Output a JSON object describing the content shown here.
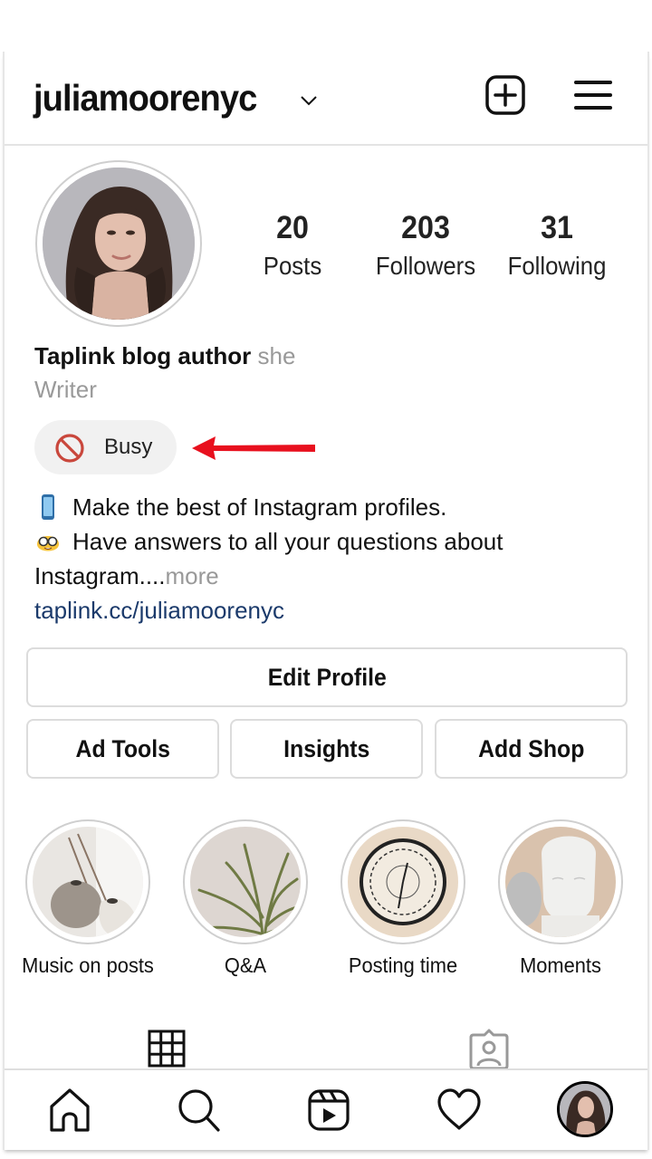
{
  "header": {
    "username": "juliamoorenyc",
    "switch_account_icon": "chevron-down-icon",
    "new_post_icon": "plus-square-icon",
    "menu_icon": "hamburger-menu-icon"
  },
  "profile": {
    "avatar_alt": "Profile photo of woman with long dark curly hair",
    "stats": [
      {
        "value": "20",
        "label": "Posts"
      },
      {
        "value": "203",
        "label": "Followers"
      },
      {
        "value": "31",
        "label": "Following"
      }
    ],
    "name": "Taplink blog author",
    "pronoun": "she",
    "category": "Writer",
    "status": {
      "icon": "prohibited-icon",
      "label": "Busy"
    },
    "bio": {
      "line1_emoji": "mobile-phone-emoji",
      "line1": "Make the best of Instagram profiles.",
      "line2_emoji": "nerd-face-emoji",
      "line2": "Have answers to all your questions about",
      "line3": "Instagram....",
      "more": " more",
      "link": "taplink.cc/juliamoorenyc"
    }
  },
  "annotation": {
    "arrow_color": "#e8101e"
  },
  "buttons": {
    "edit_profile": "Edit Profile",
    "ad_tools": "Ad Tools",
    "insights": "Insights",
    "add_shop": "Add Shop"
  },
  "highlights": [
    {
      "label": "Music on posts",
      "image": "white vases with dried flowers"
    },
    {
      "label": "Q&A",
      "image": "air plant against beige wall"
    },
    {
      "label": "Posting time",
      "image": "vintage roman numeral wall clock"
    },
    {
      "label": "Moments",
      "image": "white buddha head statues"
    }
  ],
  "tabs": [
    {
      "name": "posts-grid",
      "icon": "grid-icon",
      "active": true
    },
    {
      "name": "tagged",
      "icon": "tagged-person-icon",
      "active": false
    }
  ],
  "bottom_nav": [
    {
      "name": "home",
      "icon": "home-icon"
    },
    {
      "name": "search",
      "icon": "search-icon"
    },
    {
      "name": "reels",
      "icon": "reels-icon"
    },
    {
      "name": "activity",
      "icon": "heart-icon"
    },
    {
      "name": "profile",
      "icon": "profile-avatar"
    }
  ],
  "colors": {
    "link": "#1b3a6b",
    "muted_text": "#999999",
    "status_chip_bg": "#f1f1f1",
    "status_icon": "#c9473c",
    "border": "#dcdcdc"
  }
}
